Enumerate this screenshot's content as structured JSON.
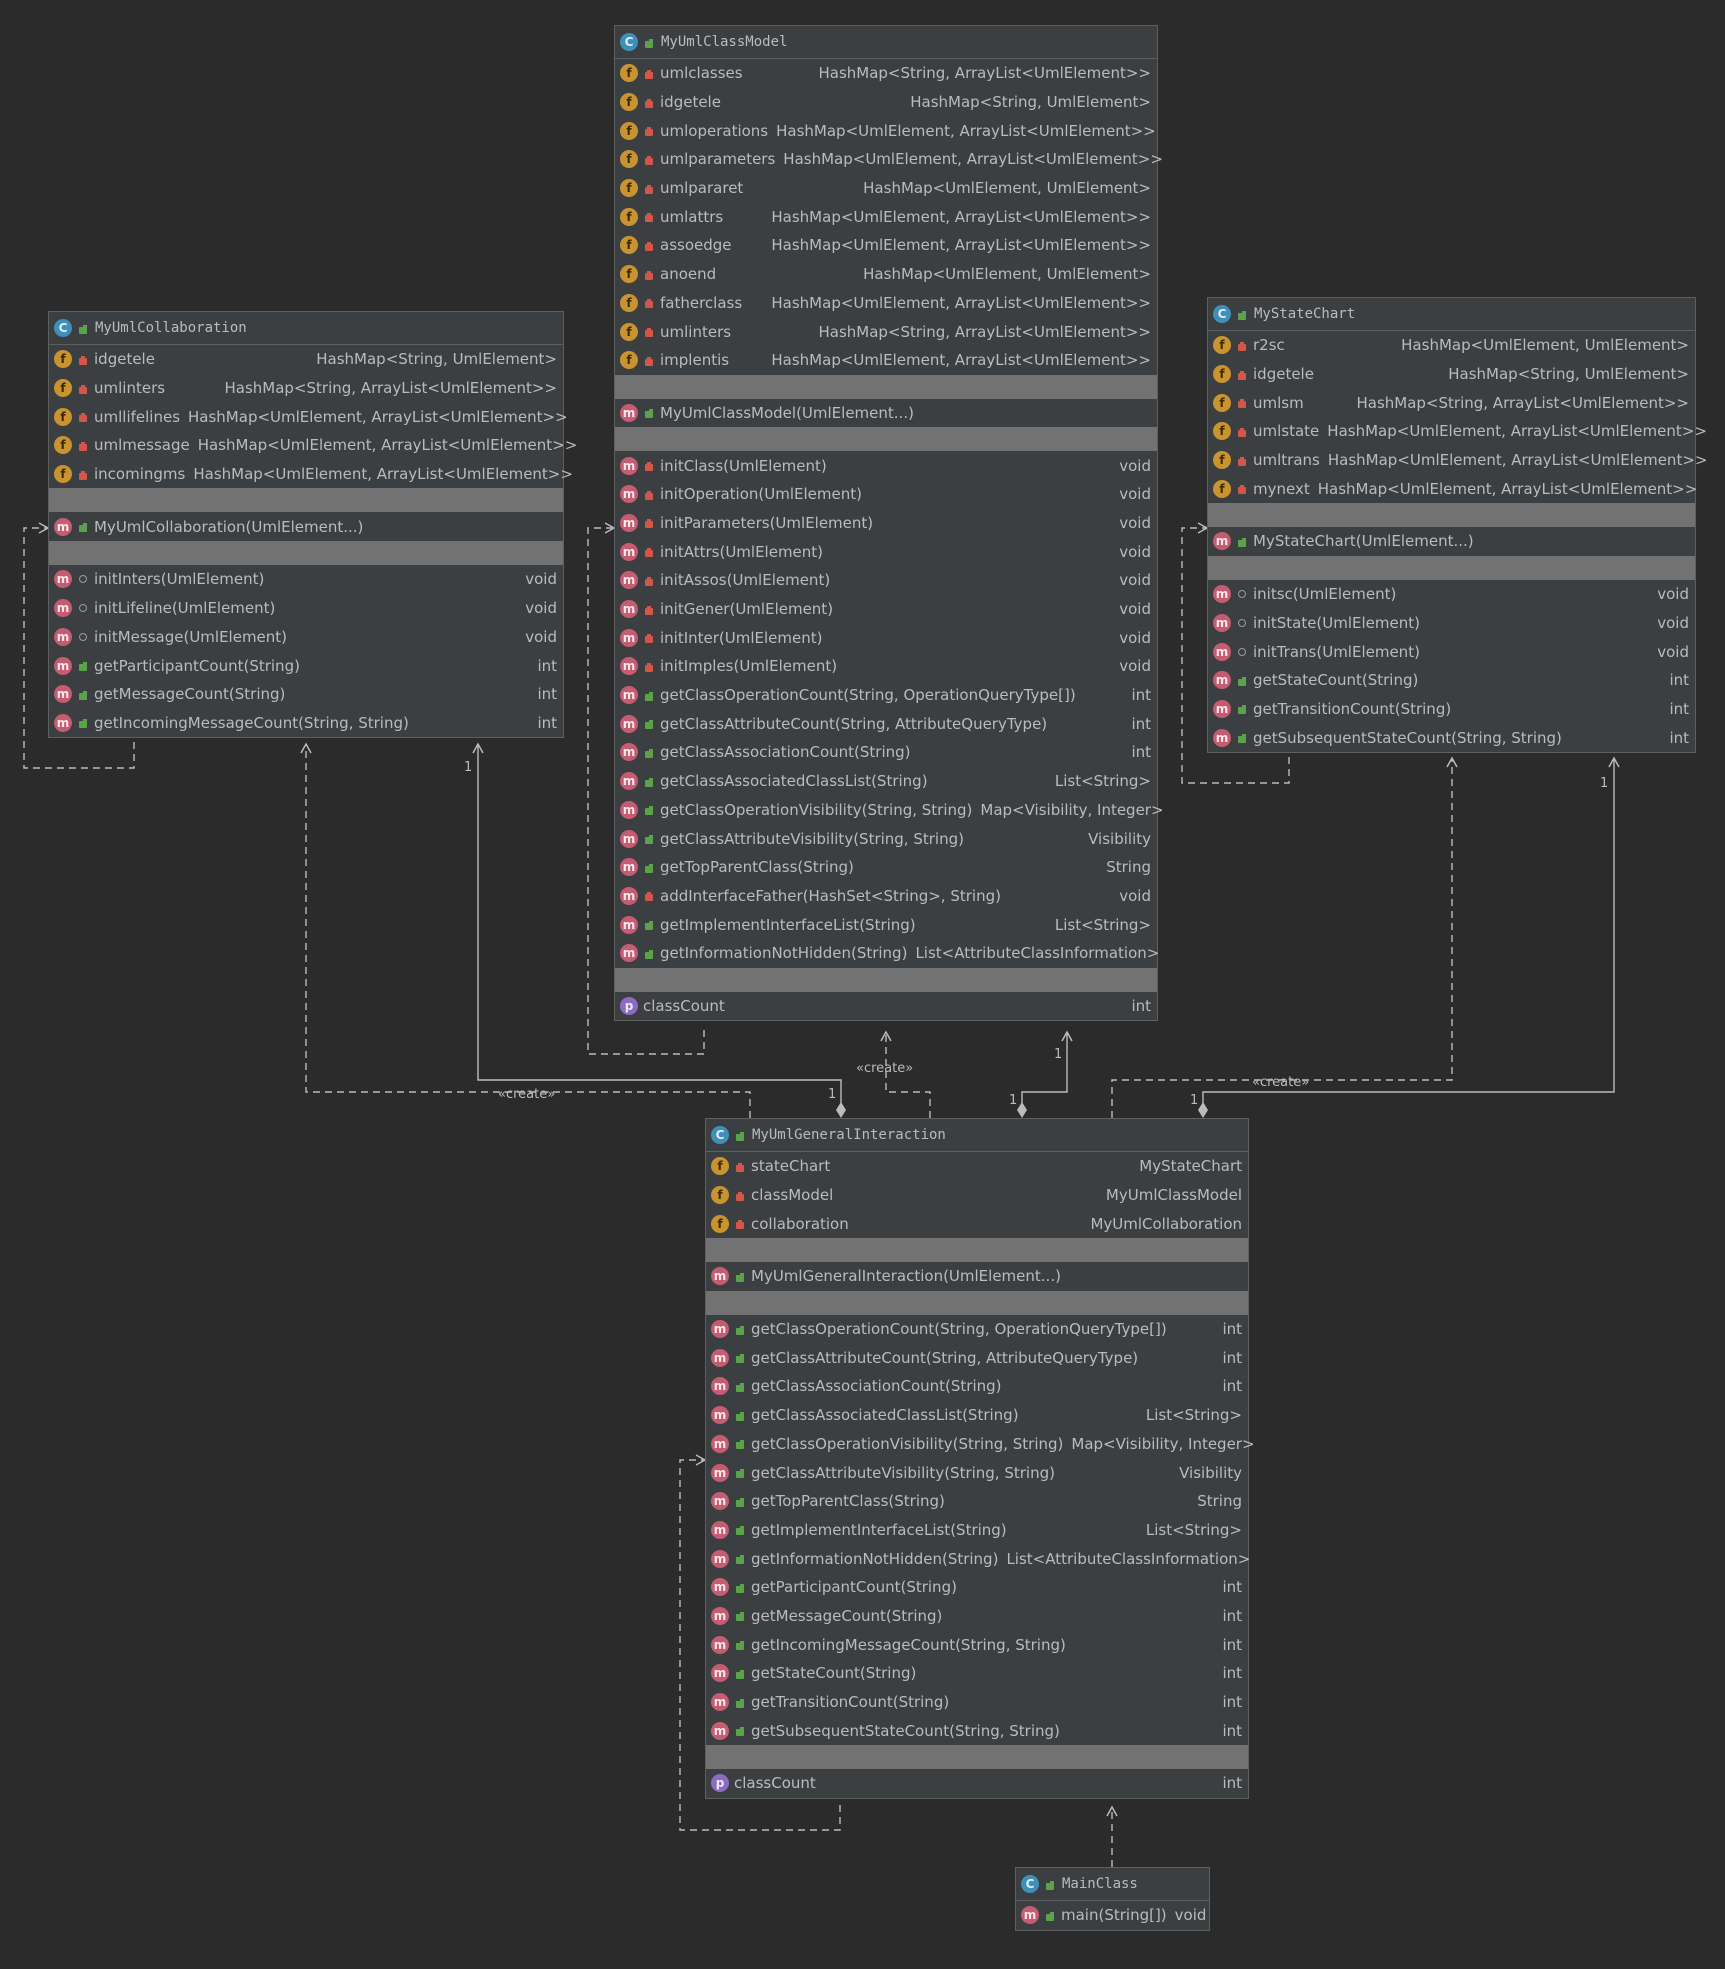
{
  "classes": {
    "classmodel": {
      "name": "MyUmlClassModel",
      "fields": [
        {
          "name": "umlclasses",
          "type": "HashMap<String, ArrayList<UmlElement>>"
        },
        {
          "name": "idgetele",
          "type": "HashMap<String, UmlElement>"
        },
        {
          "name": "umloperations",
          "type": "HashMap<UmlElement, ArrayList<UmlElement>>"
        },
        {
          "name": "umlparameters",
          "type": "HashMap<UmlElement, ArrayList<UmlElement>>"
        },
        {
          "name": "umlpararet",
          "type": "HashMap<UmlElement, UmlElement>"
        },
        {
          "name": "umlattrs",
          "type": "HashMap<UmlElement, ArrayList<UmlElement>>"
        },
        {
          "name": "assoedge",
          "type": "HashMap<UmlElement, ArrayList<UmlElement>>"
        },
        {
          "name": "anoend",
          "type": "HashMap<UmlElement, UmlElement>"
        },
        {
          "name": "fatherclass",
          "type": "HashMap<UmlElement, ArrayList<UmlElement>>"
        },
        {
          "name": "umlinters",
          "type": "HashMap<String, ArrayList<UmlElement>>"
        },
        {
          "name": "implentis",
          "type": "HashMap<UmlElement, ArrayList<UmlElement>>"
        }
      ],
      "constructor": "MyUmlClassModel(UmlElement...)",
      "methods": [
        {
          "name": "initClass(UmlElement)",
          "type": "void",
          "vis": "private"
        },
        {
          "name": "initOperation(UmlElement)",
          "type": "void",
          "vis": "private"
        },
        {
          "name": "initParameters(UmlElement)",
          "type": "void",
          "vis": "private"
        },
        {
          "name": "initAttrs(UmlElement)",
          "type": "void",
          "vis": "private"
        },
        {
          "name": "initAssos(UmlElement)",
          "type": "void",
          "vis": "private"
        },
        {
          "name": "initGener(UmlElement)",
          "type": "void",
          "vis": "private"
        },
        {
          "name": "initInter(UmlElement)",
          "type": "void",
          "vis": "private"
        },
        {
          "name": "initImples(UmlElement)",
          "type": "void",
          "vis": "private"
        },
        {
          "name": "getClassOperationCount(String, OperationQueryType[])",
          "type": "int",
          "vis": "public"
        },
        {
          "name": "getClassAttributeCount(String, AttributeQueryType)",
          "type": "int",
          "vis": "public"
        },
        {
          "name": "getClassAssociationCount(String)",
          "type": "int",
          "vis": "public"
        },
        {
          "name": "getClassAssociatedClassList(String)",
          "type": "List<String>",
          "vis": "public"
        },
        {
          "name": "getClassOperationVisibility(String, String)",
          "type": "Map<Visibility, Integer>",
          "vis": "public"
        },
        {
          "name": "getClassAttributeVisibility(String, String)",
          "type": "Visibility",
          "vis": "public"
        },
        {
          "name": "getTopParentClass(String)",
          "type": "String",
          "vis": "public"
        },
        {
          "name": "addInterfaceFather(HashSet<String>, String)",
          "type": "void",
          "vis": "private"
        },
        {
          "name": "getImplementInterfaceList(String)",
          "type": "List<String>",
          "vis": "public"
        },
        {
          "name": "getInformationNotHidden(String)",
          "type": "List<AttributeClassInformation>",
          "vis": "public"
        }
      ],
      "property": {
        "name": "classCount",
        "type": "int"
      }
    },
    "collaboration": {
      "name": "MyUmlCollaboration",
      "fields": [
        {
          "name": "idgetele",
          "type": "HashMap<String, UmlElement>"
        },
        {
          "name": "umlinters",
          "type": "HashMap<String, ArrayList<UmlElement>>"
        },
        {
          "name": "umllifelines",
          "type": "HashMap<UmlElement, ArrayList<UmlElement>>"
        },
        {
          "name": "umlmessage",
          "type": "HashMap<UmlElement, ArrayList<UmlElement>>"
        },
        {
          "name": "incomingms",
          "type": "HashMap<UmlElement, ArrayList<UmlElement>>"
        }
      ],
      "constructor": "MyUmlCollaboration(UmlElement...)",
      "methods": [
        {
          "name": "initInters(UmlElement)",
          "type": "void",
          "vis": "package"
        },
        {
          "name": "initLifeline(UmlElement)",
          "type": "void",
          "vis": "package"
        },
        {
          "name": "initMessage(UmlElement)",
          "type": "void",
          "vis": "package"
        },
        {
          "name": "getParticipantCount(String)",
          "type": "int",
          "vis": "public"
        },
        {
          "name": "getMessageCount(String)",
          "type": "int",
          "vis": "public"
        },
        {
          "name": "getIncomingMessageCount(String, String)",
          "type": "int",
          "vis": "public"
        }
      ]
    },
    "statechart": {
      "name": "MyStateChart",
      "fields": [
        {
          "name": "r2sc",
          "type": "HashMap<UmlElement, UmlElement>"
        },
        {
          "name": "idgetele",
          "type": "HashMap<String, UmlElement>"
        },
        {
          "name": "umlsm",
          "type": "HashMap<String, ArrayList<UmlElement>>"
        },
        {
          "name": "umlstate",
          "type": "HashMap<UmlElement, ArrayList<UmlElement>>"
        },
        {
          "name": "umltrans",
          "type": "HashMap<UmlElement, ArrayList<UmlElement>>"
        },
        {
          "name": "mynext",
          "type": "HashMap<UmlElement, ArrayList<UmlElement>>"
        }
      ],
      "constructor": "MyStateChart(UmlElement...)",
      "methods": [
        {
          "name": "initsc(UmlElement)",
          "type": "void",
          "vis": "package"
        },
        {
          "name": "initState(UmlElement)",
          "type": "void",
          "vis": "package"
        },
        {
          "name": "initTrans(UmlElement)",
          "type": "void",
          "vis": "package"
        },
        {
          "name": "getStateCount(String)",
          "type": "int",
          "vis": "public"
        },
        {
          "name": "getTransitionCount(String)",
          "type": "int",
          "vis": "public"
        },
        {
          "name": "getSubsequentStateCount(String, String)",
          "type": "int",
          "vis": "public"
        }
      ]
    },
    "interaction": {
      "name": "MyUmlGeneralInteraction",
      "fields": [
        {
          "name": "stateChart",
          "type": "MyStateChart"
        },
        {
          "name": "classModel",
          "type": "MyUmlClassModel"
        },
        {
          "name": "collaboration",
          "type": "MyUmlCollaboration"
        }
      ],
      "constructor": "MyUmlGeneralInteraction(UmlElement...)",
      "methods": [
        {
          "name": "getClassOperationCount(String, OperationQueryType[])",
          "type": "int",
          "vis": "public"
        },
        {
          "name": "getClassAttributeCount(String, AttributeQueryType)",
          "type": "int",
          "vis": "public"
        },
        {
          "name": "getClassAssociationCount(String)",
          "type": "int",
          "vis": "public"
        },
        {
          "name": "getClassAssociatedClassList(String)",
          "type": "List<String>",
          "vis": "public"
        },
        {
          "name": "getClassOperationVisibility(String, String)",
          "type": "Map<Visibility, Integer>",
          "vis": "public"
        },
        {
          "name": "getClassAttributeVisibility(String, String)",
          "type": "Visibility",
          "vis": "public"
        },
        {
          "name": "getTopParentClass(String)",
          "type": "String",
          "vis": "public"
        },
        {
          "name": "getImplementInterfaceList(String)",
          "type": "List<String>",
          "vis": "public"
        },
        {
          "name": "getInformationNotHidden(String)",
          "type": "List<AttributeClassInformation>",
          "vis": "public"
        },
        {
          "name": "getParticipantCount(String)",
          "type": "int",
          "vis": "public"
        },
        {
          "name": "getMessageCount(String)",
          "type": "int",
          "vis": "public"
        },
        {
          "name": "getIncomingMessageCount(String, String)",
          "type": "int",
          "vis": "public"
        },
        {
          "name": "getStateCount(String)",
          "type": "int",
          "vis": "public"
        },
        {
          "name": "getTransitionCount(String)",
          "type": "int",
          "vis": "public"
        },
        {
          "name": "getSubsequentStateCount(String, String)",
          "type": "int",
          "vis": "public"
        }
      ],
      "property": {
        "name": "classCount",
        "type": "int"
      }
    },
    "main": {
      "name": "MainClass",
      "methods": [
        {
          "name": "main(String[])",
          "type": "void",
          "vis": "public"
        }
      ]
    }
  },
  "labels": {
    "create": "«create»",
    "one": "1"
  },
  "icons": {
    "class": "C",
    "field": "f",
    "method": "m",
    "property": "p"
  },
  "colors": {
    "background": "#2b2b2b",
    "box": "#3c3f41",
    "separator": "#727272",
    "class_icon": "#3f8fb8",
    "field_icon": "#c9942f",
    "method_icon": "#c45c72",
    "property_icon": "#8b6cc2",
    "line": "#bbbbbb"
  }
}
